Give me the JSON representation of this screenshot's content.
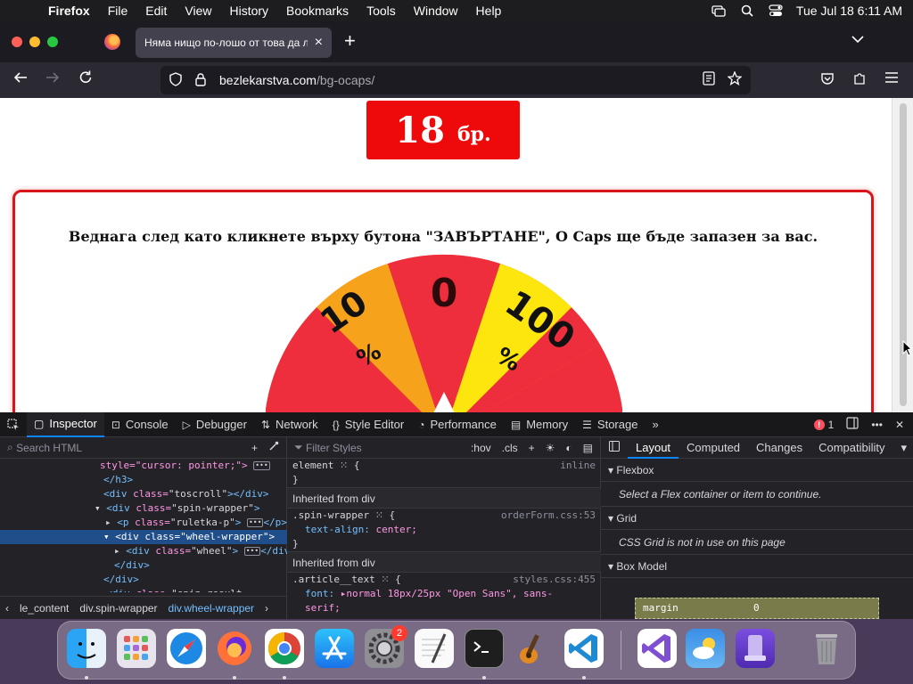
{
  "menubar": {
    "app_name": "Firefox",
    "items": [
      "File",
      "Edit",
      "View",
      "History",
      "Bookmarks",
      "Tools",
      "Window",
      "Help"
    ],
    "clock": "Tue Jul 18  6:11 AM"
  },
  "browser": {
    "tab_title": "Няма нищо по-лошо от това да лежиш",
    "url_domain": "bezlekarstva.com",
    "url_path": "/bg-ocaps/"
  },
  "page": {
    "quantity": "18",
    "quantity_unit": "бр.",
    "promo_text": "Веднага след като кликнете върху бутона \"ЗАВЪРТАНЕ\", O Caps ще бъде запазен за вас.",
    "wheel_segments": [
      {
        "label": "10",
        "suffix": "%",
        "color": "#f7a21b"
      },
      {
        "label": "0",
        "suffix": "",
        "color": "#ee2e3c"
      },
      {
        "label": "100",
        "suffix": "%",
        "color": "#fde60d"
      }
    ]
  },
  "devtools": {
    "tabs": [
      "Inspector",
      "Console",
      "Debugger",
      "Network",
      "Style Editor",
      "Performance",
      "Memory",
      "Storage"
    ],
    "error_count": "1",
    "search_html_placeholder": "Search HTML",
    "filter_styles_placeholder": "Filter Styles",
    "hov": ":hov",
    "cls": ".cls",
    "html_lines": [
      {
        "indent": 112,
        "parts": [
          [
            "attr",
            "style=\"cursor: pointer;\">"
          ],
          [
            "val",
            " "
          ]
        ],
        "ellipsis": true,
        "tail": ""
      },
      {
        "indent": 116,
        "parts": [
          [
            "tag",
            "</h3>"
          ]
        ],
        "ellipsis": false,
        "tail": ""
      },
      {
        "indent": 116,
        "parts": [
          [
            "tag",
            "<div "
          ],
          [
            "attr",
            "class="
          ],
          [
            "val",
            "\"toscroll\""
          ],
          [
            "tag",
            "></div>"
          ]
        ],
        "ellipsis": false,
        "tail": ""
      },
      {
        "indent": 106,
        "parts": [
          [
            "val",
            "▾ "
          ],
          [
            "tag",
            "<div "
          ],
          [
            "attr",
            "class="
          ],
          [
            "val",
            "\"spin-wrapper\""
          ],
          [
            "tag",
            ">"
          ]
        ],
        "ellipsis": false,
        "tail": ""
      },
      {
        "indent": 118,
        "parts": [
          [
            "val",
            "▸ "
          ],
          [
            "tag",
            "<p "
          ],
          [
            "attr",
            "class="
          ],
          [
            "val",
            "\"ruletka-p\""
          ],
          [
            "tag",
            ">"
          ]
        ],
        "ellipsis": true,
        "tail": "</p>"
      },
      {
        "indent": 116,
        "parts": [
          [
            "val",
            "▾ "
          ],
          [
            "tag",
            "<div "
          ],
          [
            "attr",
            "class="
          ],
          [
            "val",
            "\"wheel-wrapper\""
          ],
          [
            "tag",
            ">"
          ]
        ],
        "ellipsis": false,
        "tail": "",
        "selected": true
      },
      {
        "indent": 128,
        "parts": [
          [
            "val",
            "▸ "
          ],
          [
            "tag",
            "<div "
          ],
          [
            "attr",
            "class="
          ],
          [
            "val",
            "\"wheel\""
          ],
          [
            "tag",
            ">"
          ]
        ],
        "ellipsis": true,
        "tail": "</div>"
      },
      {
        "indent": 128,
        "parts": [
          [
            "tag",
            "</div>"
          ]
        ],
        "ellipsis": false,
        "tail": ""
      },
      {
        "indent": 116,
        "parts": [
          [
            "tag",
            "</div>"
          ]
        ],
        "ellipsis": false,
        "tail": ""
      },
      {
        "indent": 106,
        "parts": [
          [
            "val",
            "▸ "
          ],
          [
            "tag",
            "<div "
          ],
          [
            "attr",
            "class="
          ],
          [
            "val",
            "\"spin-result-"
          ]
        ],
        "ellipsis": false,
        "tail": ""
      }
    ],
    "breadcrumbs": [
      "le_content",
      "div.spin-wrapper",
      "div.wheel-wrapper"
    ],
    "rules": {
      "element_selector": "element",
      "element_brace": "{",
      "element_src": "inline",
      "element_close": "}",
      "inherited_1": "Inherited from div",
      "spin_selector": ".spin-wrapper",
      "spin_src": "orderForm.css:53",
      "spin_prop": "text-align",
      "spin_val": "center;",
      "inherited_2": "Inherited from div",
      "article_selector": ".article__text",
      "article_src": "styles.css:455",
      "article_prop": "font",
      "article_val": "normal 18px/25px \"Open Sans\", sans-",
      "article_val2": "serif;"
    },
    "layout_tabs": [
      "Layout",
      "Computed",
      "Changes",
      "Compatibility"
    ],
    "flexbox_title": "Flexbox",
    "flexbox_msg": "Select a Flex container or item to continue.",
    "grid_title": "Grid",
    "grid_msg": "CSS Grid is not in use on this page",
    "boxmodel_title": "Box Model",
    "margin_label": "margin",
    "margin_value": "0"
  },
  "dock": {
    "settings_badge": "2",
    "apps": [
      "Finder",
      "Launchpad",
      "Safari",
      "Firefox",
      "Chrome",
      "App Store",
      "System Settings",
      "TextEdit",
      "Terminal",
      "GarageBand",
      "Visual Studio Code",
      "Visual Studio",
      "Weather",
      "Simulator",
      "Trash"
    ]
  }
}
